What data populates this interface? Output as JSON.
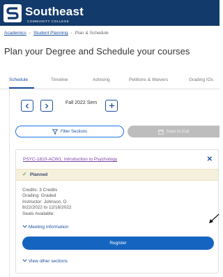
{
  "brand": {
    "name": "Southeast",
    "subtitle": "Community College",
    "colors": {
      "header": "#123a6b",
      "link": "#1a4f9c",
      "register": "#1565c0",
      "course_link": "#7b3fa0"
    }
  },
  "breadcrumb": [
    "Academics",
    "Student Planning",
    "Plan & Schedule"
  ],
  "page_title": "Plan your Degree and Schedule your courses",
  "tabs": [
    {
      "label": "Schedule",
      "active": true
    },
    {
      "label": "Timeline",
      "active": false
    },
    {
      "label": "Advising",
      "active": false
    },
    {
      "label": "Petitions & Waivers",
      "active": false
    },
    {
      "label": "Grading IOs",
      "active": false
    }
  ],
  "term": {
    "label": "Fall 2022 Sem",
    "prev_icon": "chevron-left-icon",
    "next_icon": "chevron-right-icon",
    "add_icon": "plus-icon"
  },
  "actions": {
    "filter_label": "Filter Sections",
    "filter_icon": "funnel-icon",
    "ical_label": "Save to iCal",
    "ical_icon": "calendar-icon"
  },
  "course": {
    "title": "PSYC-1810-ACW1: Introduction to Psychology",
    "status": "Planned",
    "details": [
      "Credits: 3 Credits",
      "Grading: Graded",
      "Instructor: Johnson, D",
      "8/22/2022 to 12/16/2022",
      "Seats Available:"
    ],
    "meeting_info_label": "Meeting Information",
    "register_label": "Register",
    "other_sections_label": "View other sections"
  }
}
